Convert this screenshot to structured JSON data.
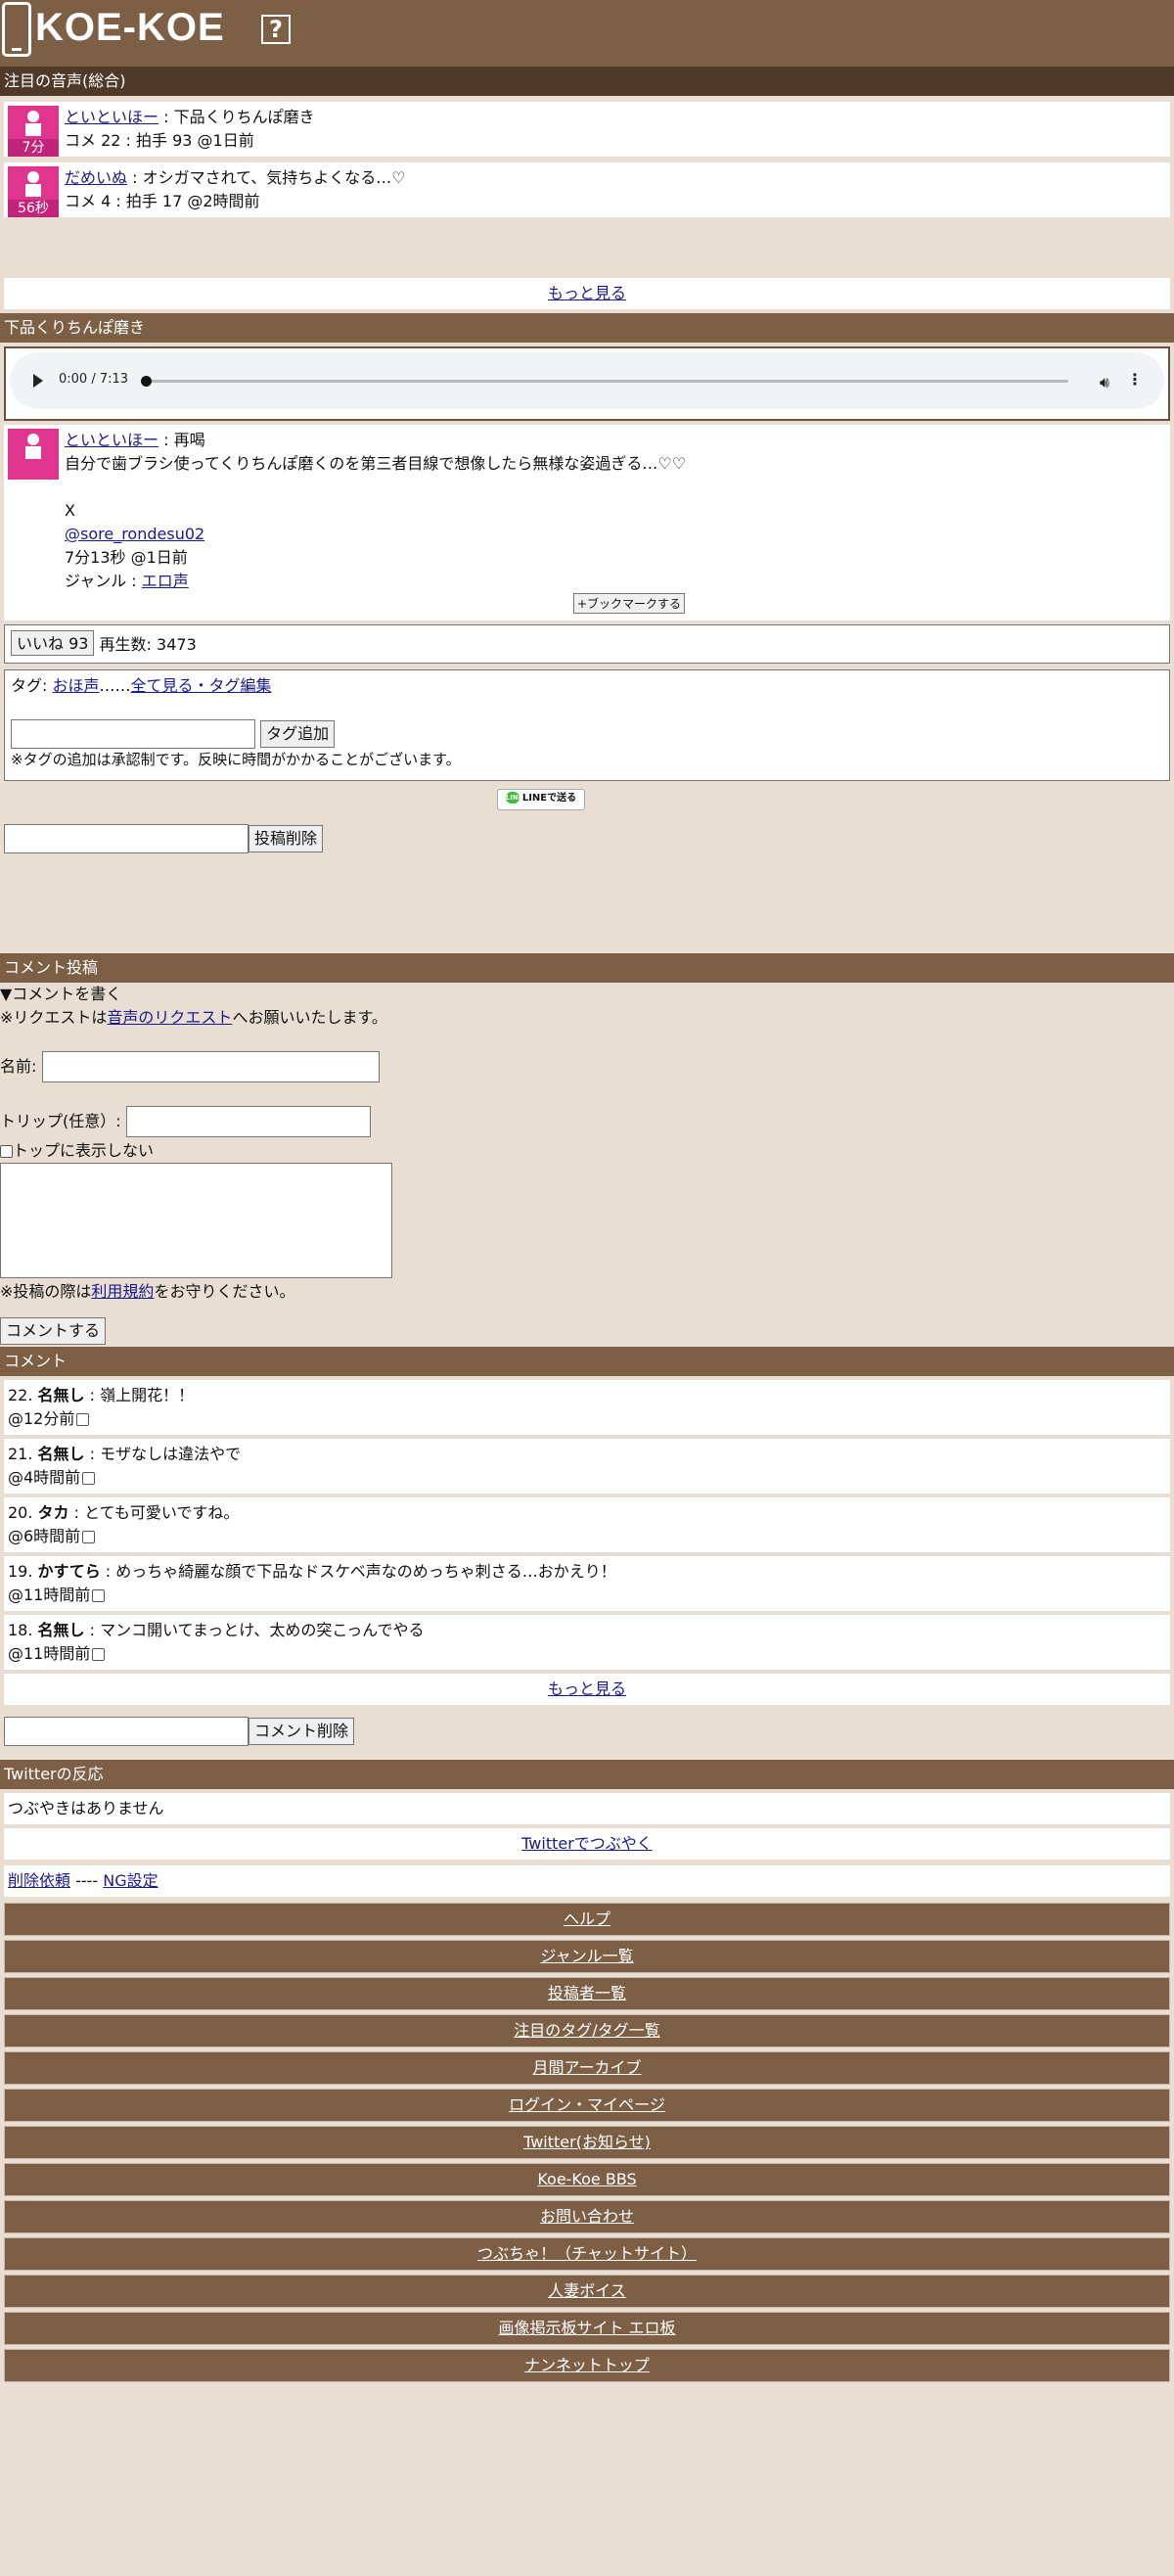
{
  "header": {
    "logo": "KOE-KOE",
    "help_glyph": "?"
  },
  "featured": {
    "title": "注目の音声(総合)",
    "items": [
      {
        "avatar_time": "7分",
        "user": "といといほー",
        "sep": " : ",
        "title": "下品くりちんぽ磨き",
        "meta": "コメ 22 : 拍手 93 @1日前"
      },
      {
        "avatar_time": "56秒",
        "user": "だめいぬ",
        "sep": " : ",
        "title": "オシガマされて、気持ちよくなる…♡",
        "meta": "コメ 4 : 拍手 17 @2時間前"
      }
    ],
    "more": "もっと見る"
  },
  "post": {
    "title": "下品くりちんぽ磨き",
    "player": {
      "time": "0:00 / 7:13",
      "progress": 0
    },
    "user": "といといほー",
    "user_sep": " : 再喝",
    "description": "自分で歯ブラシ使ってくりちんぽ磨くのを第三者目線で想像したら無様な姿過ぎる…♡♡",
    "x_label": "X",
    "x_handle": "@sore_rondesu02",
    "duration_line": "7分13秒 @1日前",
    "genre_label": "ジャンル : ",
    "genre": "エロ声",
    "bookmark": "+ブックマークする",
    "like_button": "いいね 93",
    "plays": "再生数: 3473"
  },
  "tags": {
    "label": "タグ: ",
    "tag1": "おほ声",
    "dots": "……",
    "view_all": "全て見る・タグ編集",
    "add_button": "タグ追加",
    "note": "※タグの追加は承認制です。反映に時間がかかることがございます。"
  },
  "line_share": "LINEで送る",
  "line_icon": "LINE",
  "delete_post_button": "投稿削除",
  "comment_form": {
    "title": "コメント投稿",
    "toggle": "▼コメントを書く",
    "request_prefix": "※リクエストは",
    "request_link": "音声のリクエスト",
    "request_suffix": "へお願いいたします。",
    "name_label": "名前:",
    "trip_label": "トリップ(任意）:",
    "hide_top": "トップに表示しない",
    "terms_prefix": "※投稿の際は",
    "terms_link": "利用規約",
    "terms_suffix": "をお守りください。",
    "submit": "コメントする"
  },
  "comments": {
    "title": "コメント",
    "items": [
      {
        "num": "22.",
        "name": "名無し",
        "text": " : 嶺上開花！！",
        "time": "@12分前"
      },
      {
        "num": "21.",
        "name": "名無し",
        "text": " : モザなしは違法やで",
        "time": "@4時間前"
      },
      {
        "num": "20.",
        "name": "タカ",
        "text": " : とても可愛いですね。",
        "time": "@6時間前"
      },
      {
        "num": "19.",
        "name": "かすてら",
        "text": " : めっちゃ綺麗な顔で下品なドスケベ声なのめっちゃ刺さる…おかえり！",
        "time": "@11時間前"
      },
      {
        "num": "18.",
        "name": "名無し",
        "text": " : マンコ開いてまっとけ、太めの突こっんでやる",
        "time": "@11時間前"
      }
    ],
    "more": "もっと見る",
    "delete_button": "コメント削除"
  },
  "twitter": {
    "title": "Twitterの反応",
    "none": "つぶやきはありません",
    "tweet_link": "Twitterでつぶやく"
  },
  "footer_links": {
    "delete_request": "削除依頼",
    "sep": " ---- ",
    "ng": "NG設定"
  },
  "nav": [
    "ヘルプ",
    "ジャンル一覧",
    "投稿者一覧",
    "注目のタグ/タグ一覧",
    "月間アーカイブ",
    "ログイン・マイページ",
    "Twitter(お知らせ)",
    "Koe-Koe BBS",
    "お問い合わせ",
    "つぶちゃ！（チャットサイト）",
    "人妻ボイス",
    "画像掲示板サイト エロ板",
    "ナンネットトップ"
  ]
}
